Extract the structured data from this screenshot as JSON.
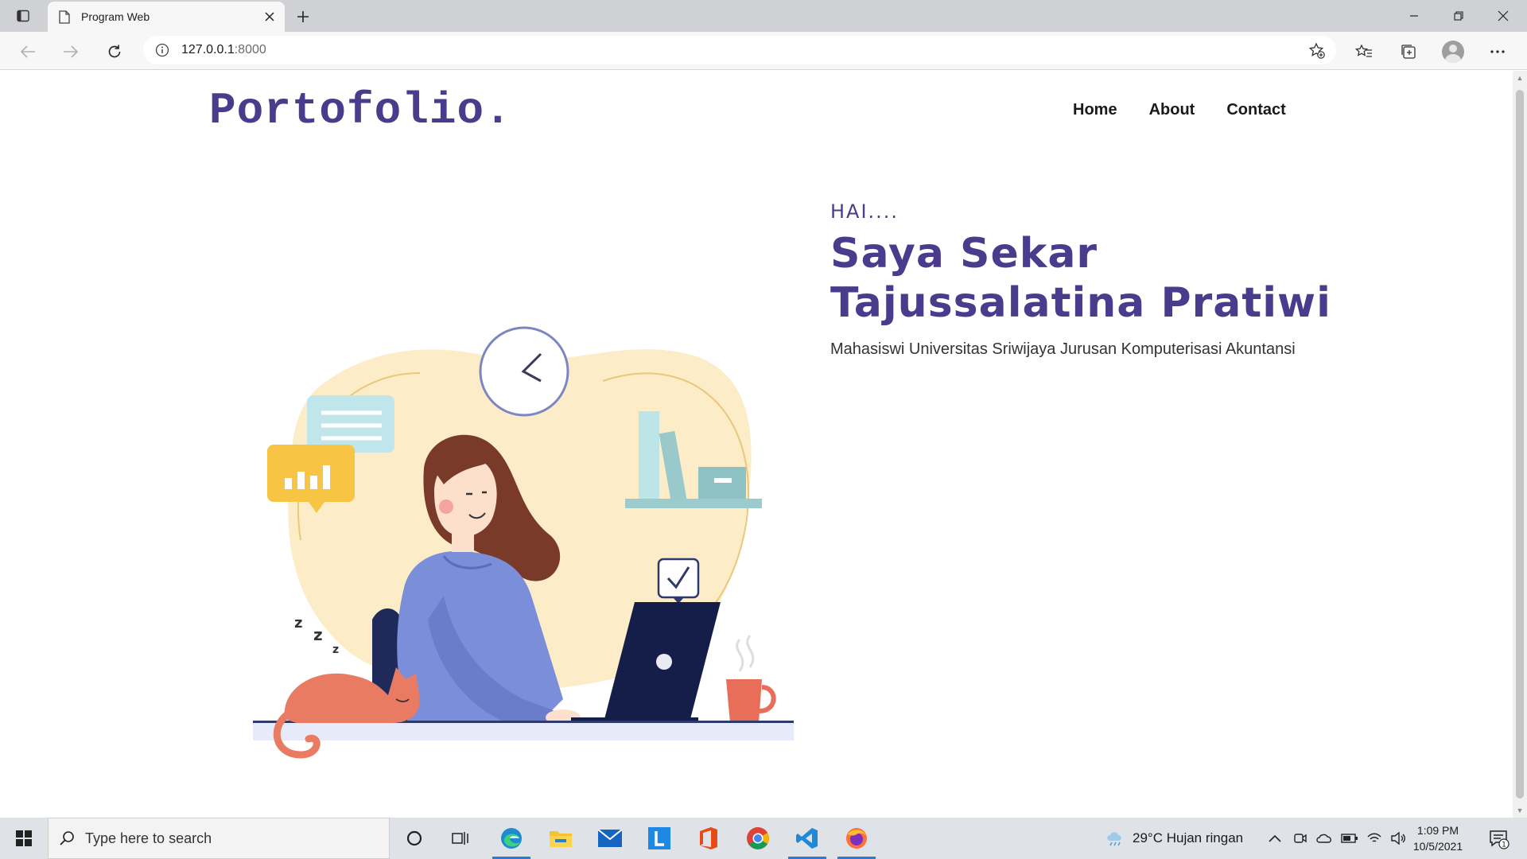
{
  "browser": {
    "tab_title": "Program Web",
    "url_host": "127.0.0.1",
    "url_port": ":8000"
  },
  "site": {
    "logo": "Portofolio.",
    "nav": [
      "Home",
      "About",
      "Contact"
    ],
    "greeting": "HAI....",
    "name_line1": "Saya Sekar",
    "name_line2": "Tajussalatina Pratiwi",
    "description": "Mahasiswi Universitas Sriwijaya Jurusan Komputerisasi Akuntansi"
  },
  "taskbar": {
    "search_placeholder": "Type here to search",
    "weather": "29°C  Hujan ringan",
    "time": "1:09 PM",
    "date": "10/5/2021",
    "notification_count": "1"
  },
  "colors": {
    "brand": "#4a3b8c",
    "accent_blue": "#2a7bd4"
  }
}
